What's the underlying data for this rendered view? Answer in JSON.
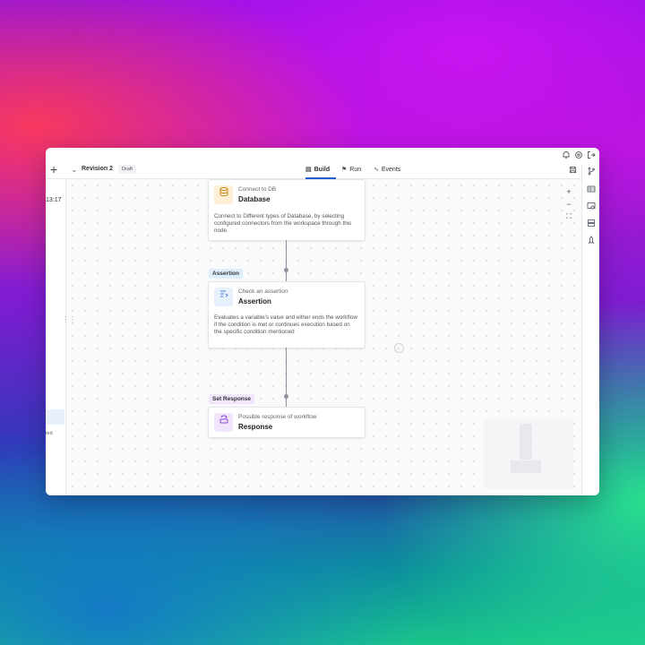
{
  "topbar": {
    "icons": [
      "bell-icon",
      "settings-icon",
      "logout-icon"
    ]
  },
  "toolbar": {
    "add_symbol": "+",
    "revision_label": "Revision 2",
    "draft_badge": "Draft",
    "tabs": [
      {
        "label": "Build",
        "icon": "layout-icon",
        "active": true
      },
      {
        "label": "Run",
        "icon": "flag-icon",
        "active": false
      },
      {
        "label": "Events",
        "icon": "activity-icon",
        "active": false
      }
    ]
  },
  "left_panel": {
    "time": "13:17",
    "status_fragment": "ted"
  },
  "right_sidebar": {
    "icons": [
      "branch-icon",
      "table-icon",
      "inspect-icon",
      "storage-icon",
      "rocket-icon"
    ]
  },
  "zoom": {
    "in": "+",
    "out": "−",
    "fit": "⛶"
  },
  "nodes": [
    {
      "subtitle": "Connect to DB",
      "title": "Database",
      "description": "Connect to Different types of Database, by selecting configured connectors from the workspace through this node.",
      "icon": "database-icon",
      "icon_color": "#f0b54a",
      "icon_bg": "#fdf0d6"
    },
    {
      "label": "Assertion",
      "label_bg": "#dfeefb",
      "subtitle": "Check an assertion",
      "title": "Assertion",
      "description": "Evaluates a variable's value and either ends the workflow if the condition is met or continues execution based on the specific condition mentioned",
      "icon": "assertion-icon",
      "icon_color": "#4a7fd6",
      "icon_bg": "#e6f0fc"
    },
    {
      "label": "Set Response",
      "label_bg": "#f1e6fb",
      "subtitle": "Possible response of workflow",
      "title": "Response",
      "icon": "response-icon",
      "icon_color": "#8c3fd1",
      "icon_bg": "#f1e6fb"
    }
  ],
  "colors": {
    "accent": "#1e5bd7",
    "edge": "#8d939e"
  }
}
